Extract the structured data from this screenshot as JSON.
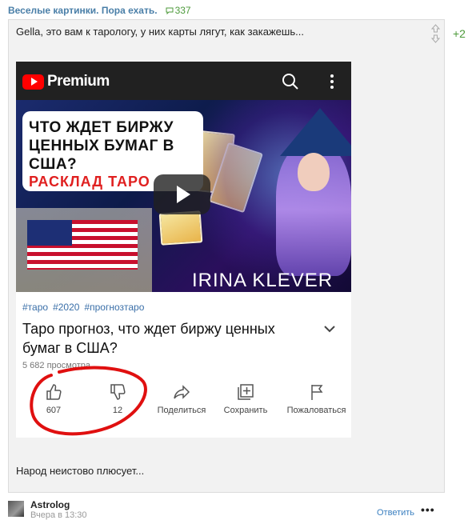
{
  "topic": {
    "title": "Веселые картинки. Пора ехать.",
    "comment_count": "337"
  },
  "post": {
    "text": "Gella, это вам к тарологу, у них карты лягут, как закажешь...",
    "score": "+2",
    "footer_text": "Народ неистово плюсует..."
  },
  "embedded": {
    "brand": "Premium",
    "thumbnail": {
      "title_lines": [
        "ЧТО ЖДЕТ БИРЖУ",
        "ЦЕННЫХ БУМАГ В",
        "США?"
      ],
      "title_red": "РАСКЛАД ТАРО",
      "author_name": "IRINA KLEVER"
    },
    "tags": [
      "#таро",
      "#2020",
      "#прогнозтаро"
    ],
    "video_title": "Таро прогноз, что ждет биржу ценных бумаг в США?",
    "views": "5 682 просмотра",
    "likes": "607",
    "dislikes": "12",
    "share_label": "Поделиться",
    "save_label": "Сохранить",
    "report_label": "Пожаловаться"
  },
  "meta": {
    "author": "Astrolog",
    "time": "Вчера в 13:30",
    "reply_label": "Ответить",
    "more_label": "•••"
  },
  "colors": {
    "accent_link": "#4a7fa8",
    "positive": "#4c9a3a",
    "youtube_red": "#ff0000"
  }
}
